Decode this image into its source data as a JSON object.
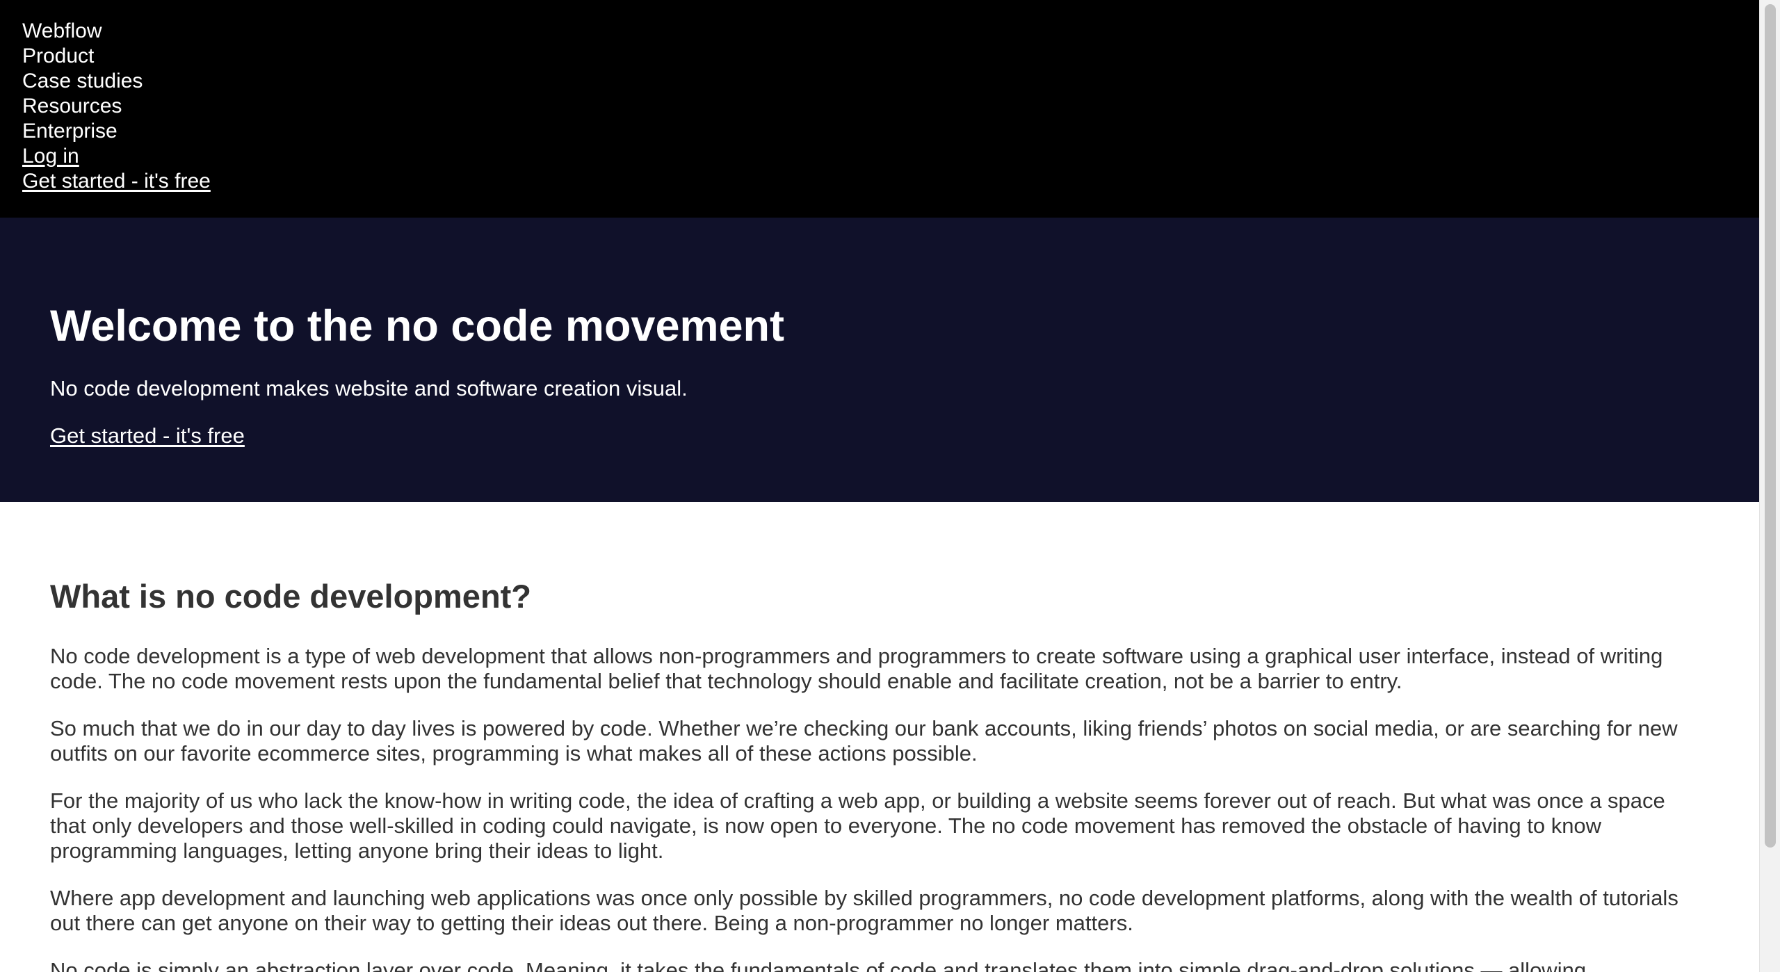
{
  "nav": {
    "items": [
      {
        "label": "Webflow"
      },
      {
        "label": "Product"
      },
      {
        "label": "Case studies"
      },
      {
        "label": "Resources"
      },
      {
        "label": "Enterprise"
      }
    ],
    "login_label": "Log in",
    "get_started_label": "Get started - it's free"
  },
  "hero": {
    "title": "Welcome to the no code movement",
    "subtitle": "No code development makes website and software creation visual.",
    "cta_label": "Get started - it's free"
  },
  "article": {
    "heading": "What is no code development?",
    "paragraphs": [
      "No code development is a type of web development that allows non-programmers and programmers to create software using a graphical user interface, instead of writing code. The no code movement rests upon the fundamental belief that technology should enable and facilitate creation, not be a barrier to entry.",
      "So much that we do in our day to day lives is powered by code. Whether we’re checking our bank accounts, liking friends’ photos on social media, or are searching for new outfits on our favorite ecommerce sites, programming is what makes all of these actions possible.",
      "For the majority of us who lack the know-how in writing code, the idea of crafting a web app, or building a website seems forever out of reach. But what was once a space that only developers and those well-skilled in coding could navigate, is now open to everyone. The no code movement has removed the obstacle of having to know programming languages, letting anyone bring their ideas to light.",
      "Where app development and launching web applications was once only possible by skilled programmers, no code development platforms, along with the wealth of tutorials out there can get anyone on their way to getting their ideas out there. Being a non-programmer no longer matters.",
      "No code is simply an abstraction layer over code. Meaning, it takes the fundamentals of code and translates them into simple drag-and-drop solutions — allowing"
    ]
  },
  "colors": {
    "nav_background": "#000000",
    "hero_background": "#10112a",
    "body_text": "#333333",
    "on_dark_text": "#ffffff"
  }
}
